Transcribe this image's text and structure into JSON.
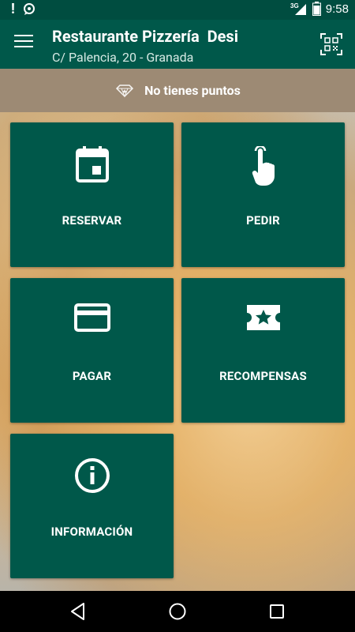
{
  "status_bar": {
    "network": "3G",
    "time": "9:58"
  },
  "app_bar": {
    "title": "Restaurante Pizzería  Desi",
    "subtitle": "C/ Palencia, 20 - Granada"
  },
  "points": {
    "label": "No tienes puntos"
  },
  "tiles": [
    {
      "label": "RESERVAR",
      "icon": "calendar-icon"
    },
    {
      "label": "PEDIR",
      "icon": "touch-hand-icon"
    },
    {
      "label": "PAGAR",
      "icon": "credit-card-icon"
    },
    {
      "label": "RECOMPENSAS",
      "icon": "star-ticket-icon"
    },
    {
      "label": "INFORMACIÓN",
      "icon": "info-icon"
    }
  ],
  "colors": {
    "primary": "#00584a",
    "status_bar": "#004d40",
    "banner": "#9d8a74"
  }
}
